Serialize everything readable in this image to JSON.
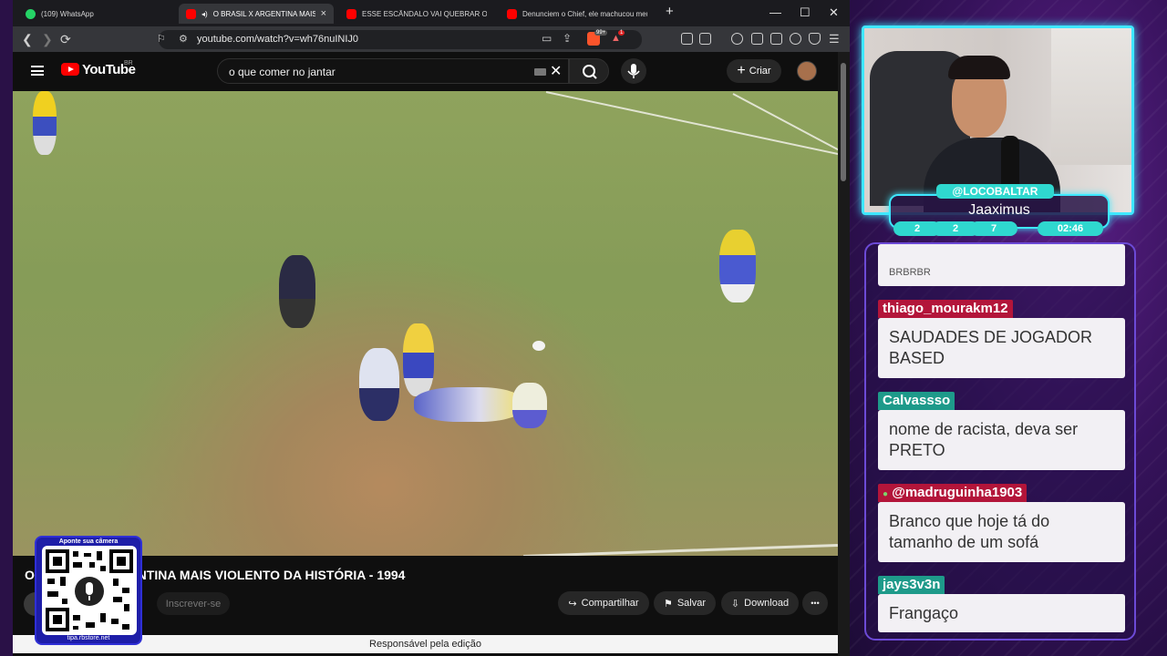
{
  "browser": {
    "tabs": [
      {
        "label": "(109) WhatsApp",
        "icon": "whatsapp-icon",
        "active": false
      },
      {
        "label": "O BRASIL X ARGENTINA MAIS VIO",
        "icon": "youtube-icon",
        "active": true
      },
      {
        "label": "ESSE ESCÂNDALO VAI QUEBRAR O BRASIL E",
        "icon": "youtube-icon",
        "active": false
      },
      {
        "label": "Denunciem o Chief, ele machucou meus ser",
        "icon": "youtube-icon",
        "active": false
      }
    ],
    "new_tab": "+",
    "window_controls": {
      "minimize": "—",
      "maximize": "☐",
      "close": "✕"
    },
    "url": "youtube.com/watch?v=wh76nuINIJ0",
    "brave_count": "99+",
    "alert_count": "1"
  },
  "youtube": {
    "logo": "YouTube",
    "region": "BR",
    "search_value": "o que comer no jantar",
    "create_label": "Criar",
    "video_title": "O BRASIL X ARGENTINA MAIS VIOLENTO DA HISTÓRIA - 1994",
    "subscribe_label": "Inscrever-se",
    "share_label": "Compartilhar",
    "save_label": "Salvar",
    "download_label": "Download",
    "more_label": "•••",
    "tooltip": "Responsável pela edição"
  },
  "qr": {
    "top_text": "Aponte sua câmera",
    "bottom_text": "tipa.rbstore.net"
  },
  "stream": {
    "handle": "@LOCOBALTAR",
    "nick": "Jaaximus",
    "stats": [
      "2",
      "2",
      "7"
    ],
    "timer": "02:46"
  },
  "chat": {
    "messages": [
      {
        "user": "",
        "text": "BRBRBR",
        "color": ""
      },
      {
        "user": "thiago_mourakm12",
        "text": "SAUDADES DE JOGADOR BASED",
        "color": "#b3153a"
      },
      {
        "user": "Calvassso",
        "text": "nome de racista, deva ser PRETO",
        "color": "#1e9a8a"
      },
      {
        "user": "@madruguinha1903",
        "text": "Branco que hoje tá do tamanho de um sofá",
        "color": "#b3153a"
      },
      {
        "user": "jays3v3n",
        "text": "Frangaço",
        "color": "#1e9a8a"
      }
    ]
  }
}
